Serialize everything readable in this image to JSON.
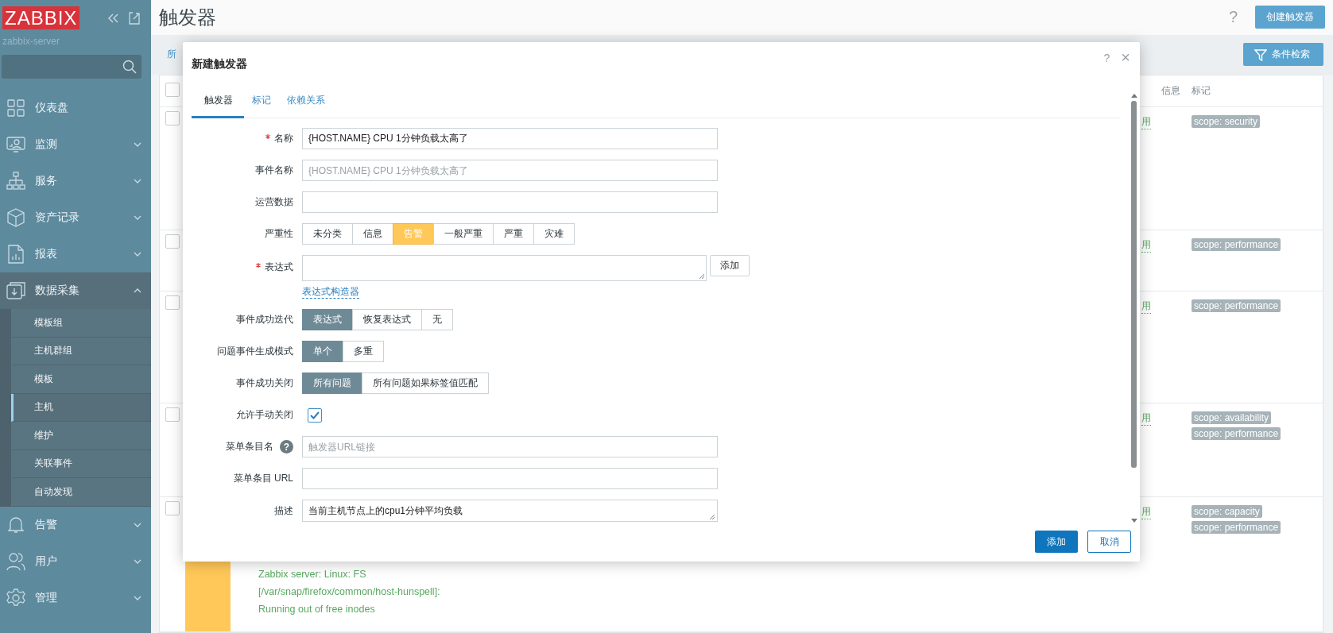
{
  "sidebar": {
    "logo": "ZABBIX",
    "server": "zabbix-server",
    "items": [
      {
        "kind": "link",
        "label": "仪表盘"
      },
      {
        "kind": "group",
        "label": "监测",
        "expanded": false
      },
      {
        "kind": "group",
        "label": "服务",
        "expanded": false
      },
      {
        "kind": "group",
        "label": "资产记录",
        "expanded": false
      },
      {
        "kind": "group",
        "label": "报表",
        "expanded": false
      },
      {
        "kind": "group",
        "label": "数据采集",
        "expanded": true,
        "children": [
          {
            "label": "模板组",
            "selected": false
          },
          {
            "label": "主机群组",
            "selected": false
          },
          {
            "label": "模板",
            "selected": false
          },
          {
            "label": "主机",
            "selected": true
          },
          {
            "label": "维护",
            "selected": false
          },
          {
            "label": "关联事件",
            "selected": false
          },
          {
            "label": "自动发现",
            "selected": false
          }
        ]
      },
      {
        "kind": "group",
        "label": "告警",
        "expanded": false
      },
      {
        "kind": "group",
        "label": "用户",
        "expanded": false
      },
      {
        "kind": "group",
        "label": "管理",
        "expanded": false
      }
    ]
  },
  "header": {
    "title": "触发器",
    "help": "?",
    "create_button": "创建触发器"
  },
  "filter": {
    "link": "所",
    "button": "条件检索"
  },
  "table": {
    "checked": false,
    "columns": [
      "信息",
      "标记"
    ],
    "rows": [
      {
        "checked": false,
        "status": "用",
        "tags": [
          "scope: security"
        ]
      },
      {
        "checked": false,
        "status": "用",
        "tags": [
          "scope: performance"
        ]
      },
      {
        "checked": false,
        "status": "用",
        "tags": [
          "scope: performance"
        ]
      },
      {
        "checked": false,
        "status": "用",
        "tags": [
          "scope: availability",
          "scope: performance"
        ]
      },
      {
        "checked": false,
        "color": "#ffc859",
        "name": "Zabbix server: Linux: FS [/var/snap/firefox/common/host-hunspell]: Running out of free inodes",
        "status": "用",
        "tags": [
          "scope: capacity",
          "scope: performance"
        ]
      }
    ]
  },
  "dialog": {
    "title": "新建触发器",
    "help": "?",
    "close": "×",
    "tabs": [
      {
        "label": "触发器",
        "selected": true
      },
      {
        "label": "标记",
        "selected": false
      },
      {
        "label": "依赖关系",
        "selected": false
      }
    ],
    "fields": [
      {
        "kind": "input",
        "label": "名称",
        "required": true,
        "value": "{HOST.NAME} CPU 1分钟负载太高了"
      },
      {
        "kind": "input",
        "label": "事件名称",
        "required": false,
        "placeholder": "{HOST.NAME} CPU 1分钟负载太高了"
      },
      {
        "kind": "input",
        "label": "运营数据",
        "required": false
      },
      {
        "kind": "severity",
        "label": "严重性",
        "options": [
          {
            "label": "未分类",
            "selected": false
          },
          {
            "label": "信息",
            "selected": false
          },
          {
            "label": "告警",
            "selected": true
          },
          {
            "label": "一般严重",
            "selected": false
          },
          {
            "label": "严重",
            "selected": false
          },
          {
            "label": "灾难",
            "selected": false
          }
        ]
      },
      {
        "kind": "expression",
        "label": "表达式",
        "required": true,
        "button": "添加",
        "link": "表达式构造器"
      },
      {
        "kind": "segmented",
        "label": "事件成功迭代",
        "options": [
          {
            "label": "表达式",
            "selected": true
          },
          {
            "label": "恢复表达式",
            "selected": false
          },
          {
            "label": "无",
            "selected": false
          }
        ]
      },
      {
        "kind": "segmented",
        "label": "问题事件生成模式",
        "options": [
          {
            "label": "单个",
            "selected": true
          },
          {
            "label": "多重",
            "selected": false
          }
        ]
      },
      {
        "kind": "segmented",
        "label": "事件成功关闭",
        "options": [
          {
            "label": "所有问题",
            "selected": true
          },
          {
            "label": "所有问题如果标签值匹配",
            "selected": false
          }
        ]
      },
      {
        "kind": "checkbox",
        "label": "允许手动关闭",
        "checked": true
      },
      {
        "kind": "input",
        "label": "菜单条目名",
        "help": "?",
        "required": false,
        "placeholder": "触发器URL链接"
      },
      {
        "kind": "input",
        "label": "菜单条目 URL",
        "required": false
      },
      {
        "kind": "textarea",
        "label": "描述",
        "value": "当前主机节点上的cpu1分钟平均负载"
      }
    ],
    "buttons": [
      {
        "kind": "primary",
        "label": "添加"
      },
      {
        "kind": "secondary",
        "label": "取消"
      }
    ]
  }
}
